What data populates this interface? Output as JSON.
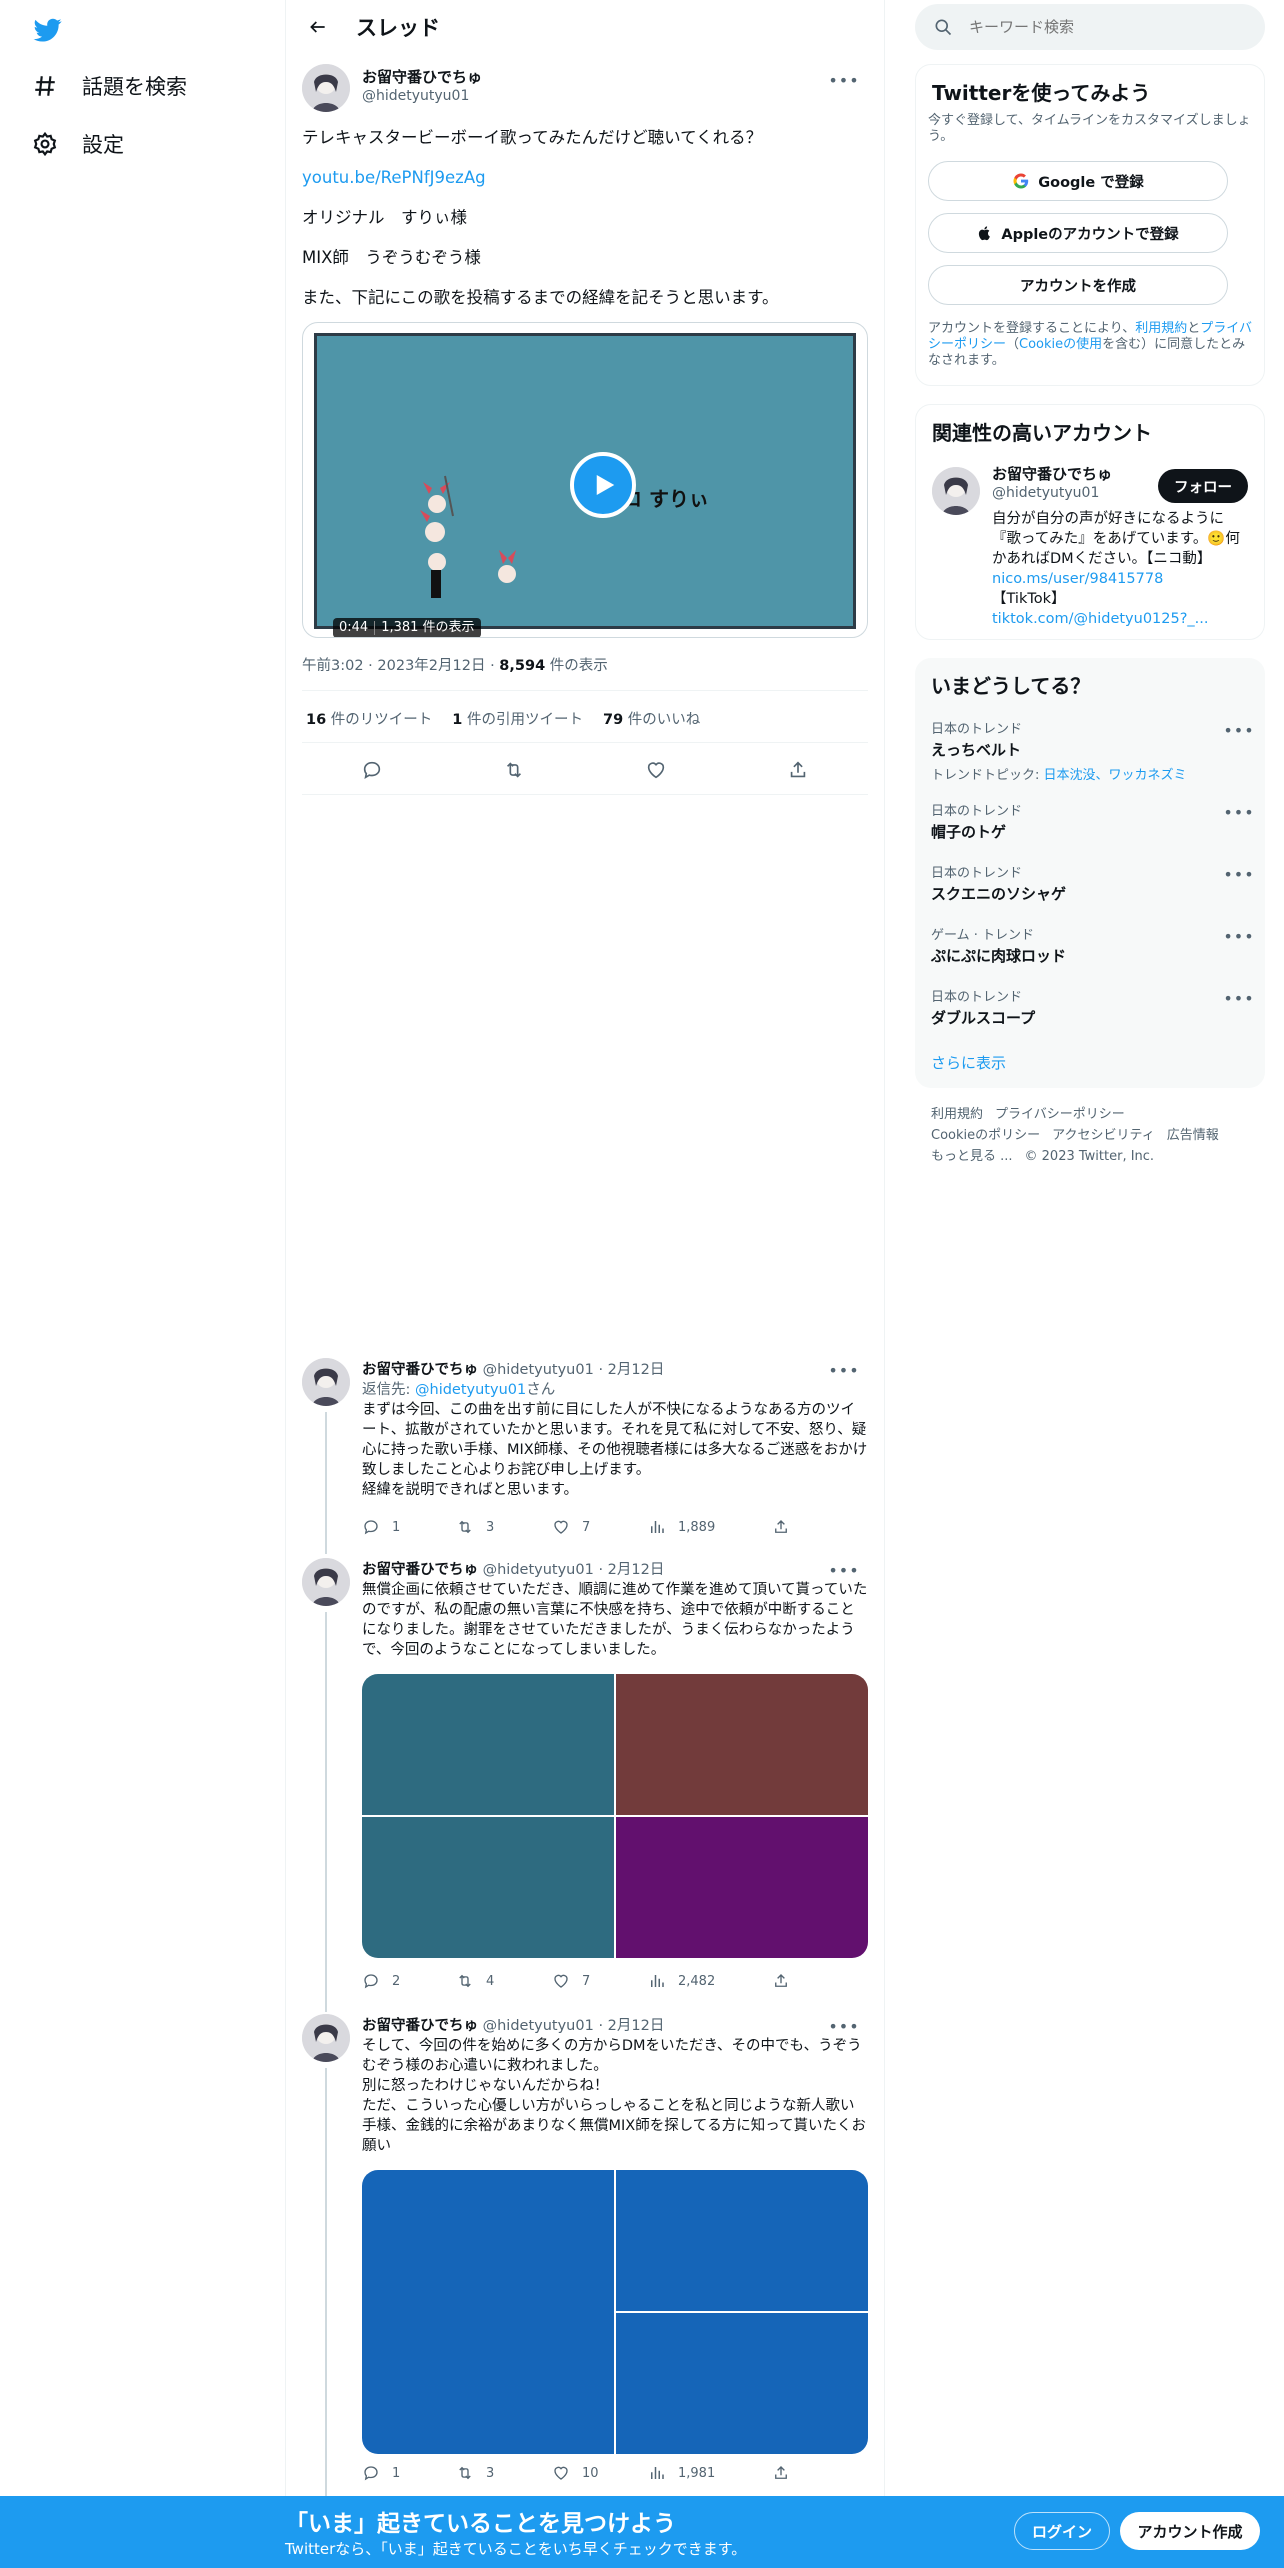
{
  "nav": {
    "explore_label": "話題を検索",
    "settings_label": "設定"
  },
  "header": {
    "title": "スレッド"
  },
  "main_tweet": {
    "name": "お留守番ひでちゅ",
    "handle": "@hidetyutyu01",
    "line1": "テレキャスタービーボーイ歌ってみたんだけど聴いてくれる？",
    "link": "youtu.be/RePNfJ9ezAg",
    "line3": "オリジナル　すりぃ様",
    "line4": "MIX師　うぞうむぞう様",
    "line5": "また、下記にこの歌を投稿するまでの経緯を記そうと思います。",
    "video_time": "0:44",
    "video_views": "1,381 件の表示",
    "video_caption": "ーソロ すりぃ",
    "time": "午前3:02",
    "date": "2023年2月12日",
    "views_count": "8,594",
    "views_label": "件の表示",
    "retweets_count": "16",
    "retweets_label": "件のリツイート",
    "quotes_count": "1",
    "quotes_label": "件の引用ツイート",
    "likes_count": "79",
    "likes_label": "件のいいね"
  },
  "replies": [
    {
      "name": "お留守番ひでちゅ",
      "handle": "@hidetyutyu01",
      "date": "2月12日",
      "reply_to_prefix": "返信先: ",
      "reply_to_handle": "@hidetyutyu01",
      "reply_to_suffix": "さん",
      "text": "まずは今回、この曲を出す前に目にした人が不快になるようなある方のツイート、拡散がされていたかと思います。それを見て私に対して不安、怒り、疑心に持った歌い手様、MIX師様、その他視聴者様には多大なるご迷惑をおかけ致しましたこと心よりお詫び申し上げます。\n経緯を説明できればと思います。",
      "replies": "1",
      "retweets": "3",
      "likes": "7",
      "views": "1,889"
    },
    {
      "name": "お留守番ひでちゅ",
      "handle": "@hidetyutyu01",
      "date": "2月12日",
      "text": "無償企画に依頼させていただき、順調に進めて作業を進めて頂いて貰っていたのですが、私の配慮の無い言葉に不快感を持ち、途中で依頼が中断することになりました。謝罪をさせていただきましたが、うまく伝わらなかったようで、今回のようなことになってしまいました。",
      "replies": "2",
      "retweets": "4",
      "likes": "7",
      "views": "2,482",
      "media_colors": [
        "#2e6b80",
        "#723b3b",
        "#2e6b80",
        "#62106e"
      ]
    },
    {
      "name": "お留守番ひでちゅ",
      "handle": "@hidetyutyu01",
      "date": "2月12日",
      "text": "そして、今回の件を始めに多くの方からDMをいただき、その中でも、うぞうむぞう様のお心遣いに救われました。\n別に怒ったわけじゃないんだからね！\nただ、こういった心優しい方がいらっしゃることを私と同じような新人歌い手様、金銭的に余裕があまりなく無償MIX師を探してる方に知って貰いたくお願い",
      "replies": "1",
      "retweets": "3",
      "likes": "10",
      "views": "1,981",
      "media_colors": [
        "#1565b8",
        "#1565b8",
        "#1565b8"
      ]
    }
  ],
  "search": {
    "placeholder": "キーワード検索"
  },
  "signup_card": {
    "title": "Twitterを使ってみよう",
    "subtitle": "今すぐ登録して、タイムラインをカスタマイズしましょう。",
    "google_label": "Google で登録",
    "apple_label": "Appleのアカウントで登録",
    "create_label": "アカウントを作成",
    "legal_prefix": "アカウントを登録することにより、",
    "legal_terms": "利用規約",
    "legal_and": "と",
    "legal_privacy": "プライバシーポリシー",
    "legal_cookie_open": "（",
    "legal_cookie": "Cookieの使用",
    "legal_suffix": "を含む）に同意したとみなされます。"
  },
  "related_card": {
    "title": "関連性の高いアカウント",
    "name": "お留守番ひでちゅ",
    "handle": "@hidetyutyu01",
    "follow_label": "フォロー",
    "bio1": "自分が自分の声が好きになるように『歌ってみた』をあげています。🙂何かあればDMください。【ニコ動】",
    "bio_link1": "nico.ms/user/98415778",
    "bio2": "【TikTok】",
    "bio_link2": "tiktok.com/@hidetyu0125?_..."
  },
  "trends_card": {
    "title": "いまどうしてる？",
    "items": [
      {
        "category": "日本のトレンド",
        "name": "えっちベルト",
        "topics_prefix": "トレンドトピック: ",
        "topics": "日本沈没、ワッカネズミ"
      },
      {
        "category": "日本のトレンド",
        "name": "帽子のトゲ"
      },
      {
        "category": "日本のトレンド",
        "name": "スクエニのソシャゲ"
      },
      {
        "category": "ゲーム · トレンド",
        "name": "ぷにぷに肉球ロッド"
      },
      {
        "category": "日本のトレンド",
        "name": "ダブルスコープ"
      }
    ],
    "show_more": "さらに表示"
  },
  "footer": {
    "terms": "利用規約",
    "privacy": "プライバシーポリシー",
    "cookie": "Cookieのポリシー",
    "accessibility": "アクセシビリティ",
    "ads": "広告情報",
    "more": "もっと見る ...",
    "copyright": "© 2023 Twitter, Inc."
  },
  "bottom_bar": {
    "title": "「いま」起きていることを見つけよう",
    "subtitle": "Twitterなら、「いま」起きていることをいち早くチェックできます。",
    "login_label": "ログイン",
    "signup_label": "アカウント作成"
  },
  "colors": {
    "brand": "#1d9bf0",
    "text": "#0f1419",
    "muted": "#536471",
    "video_bg": "#4f95a8"
  }
}
